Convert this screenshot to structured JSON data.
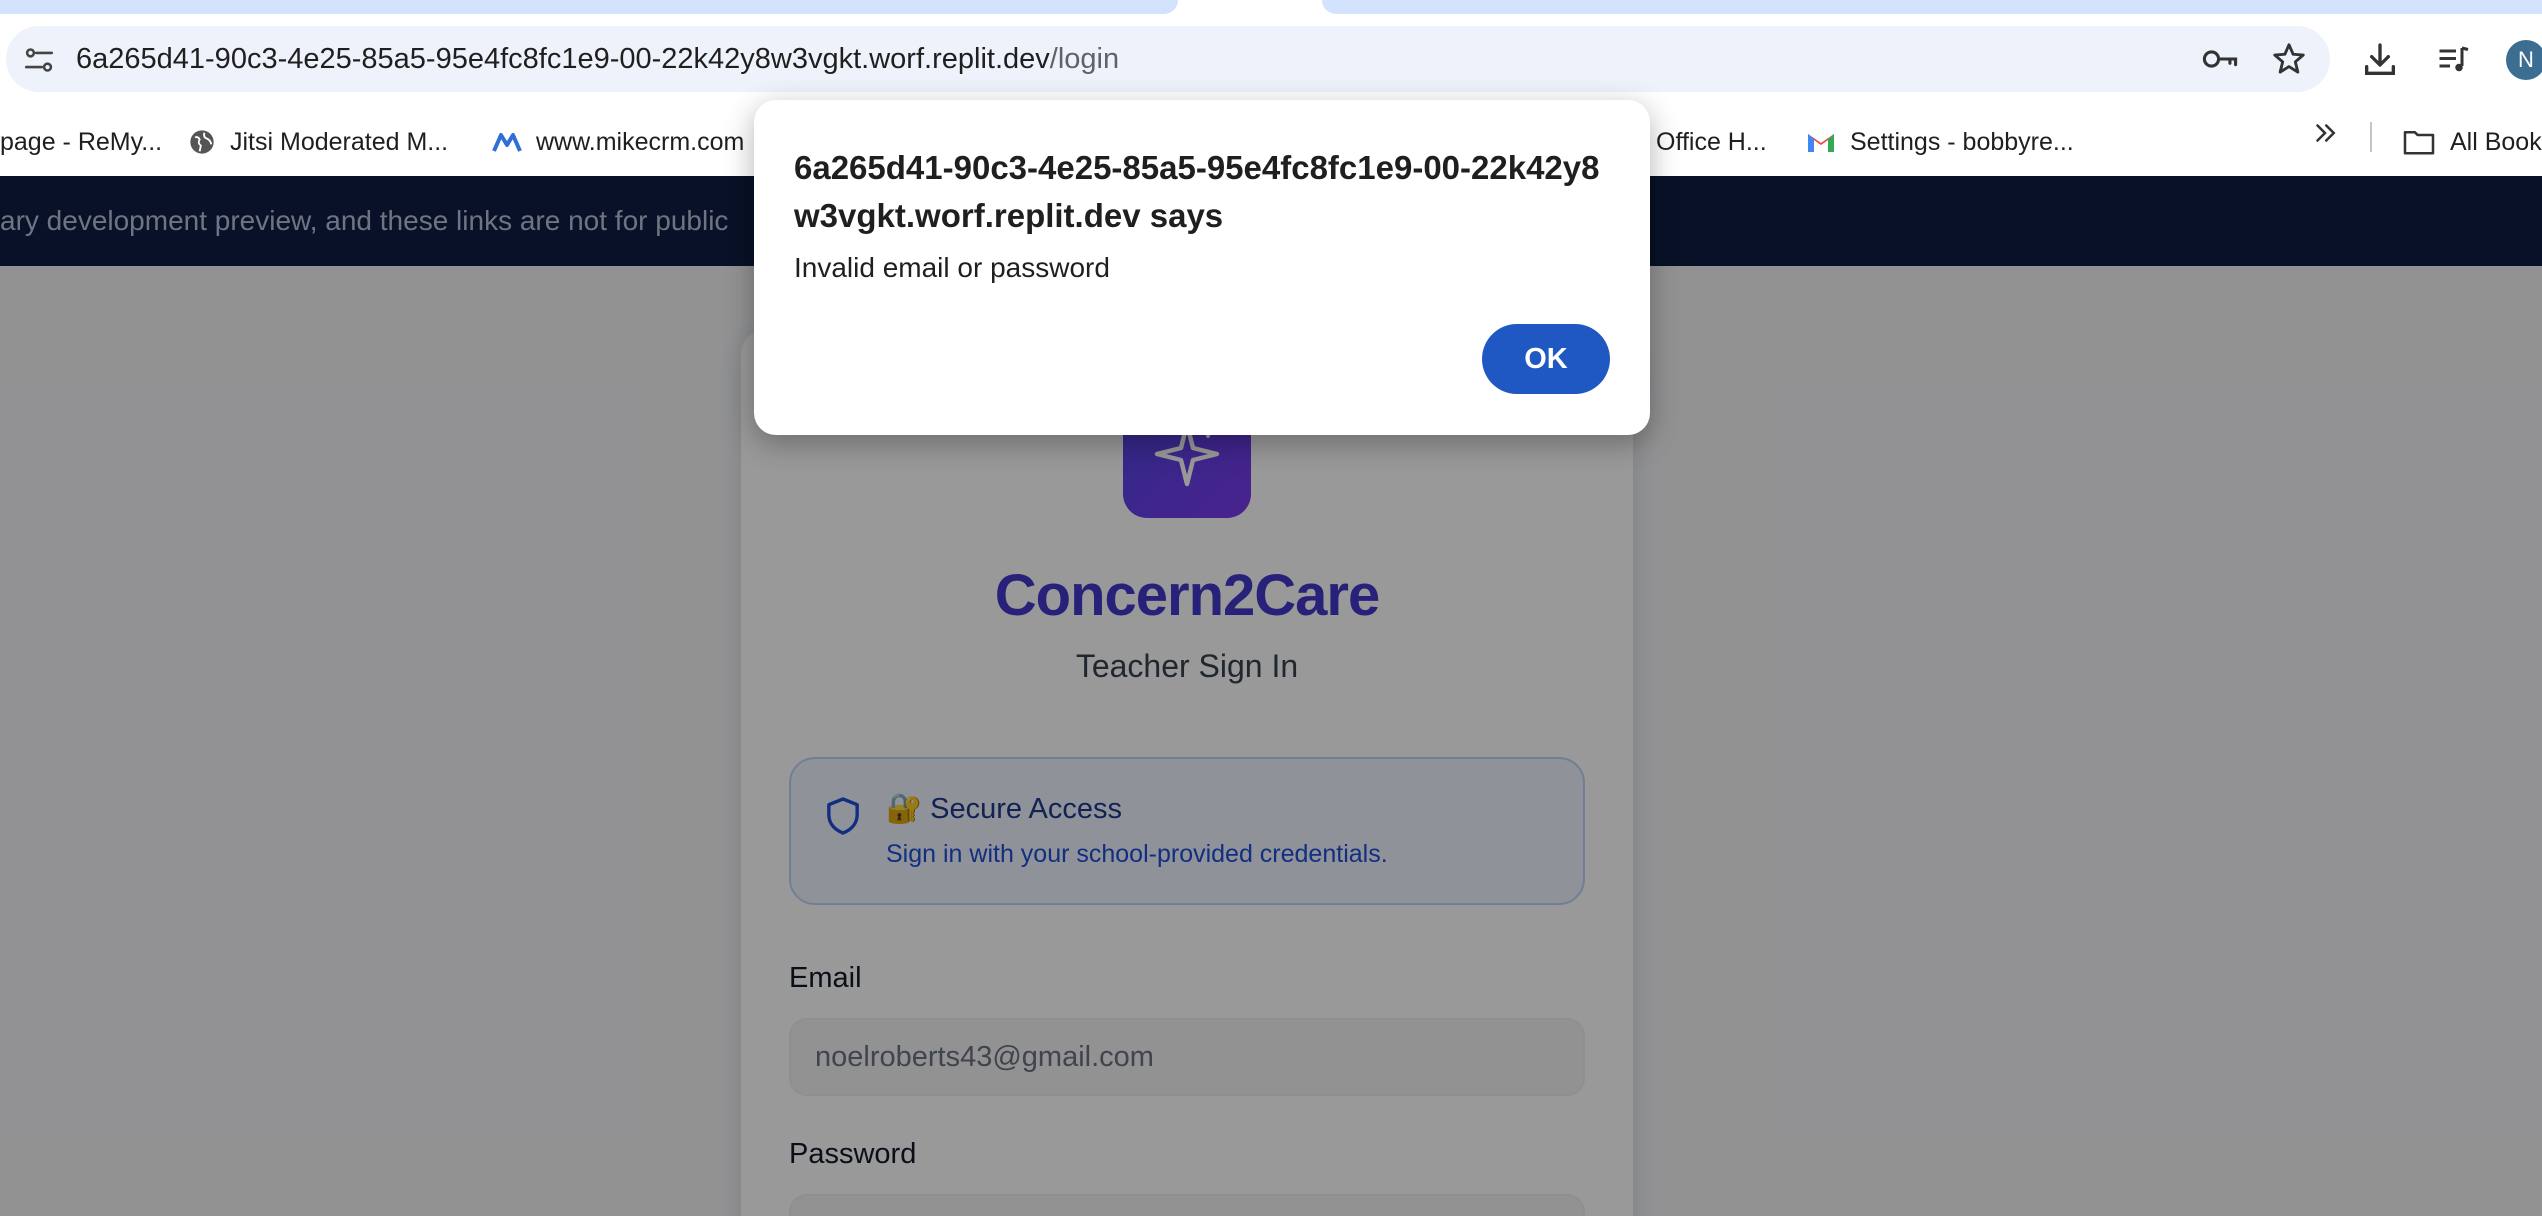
{
  "browser": {
    "address_bar": {
      "host": "6a265d41-90c3-4e25-85a5-95e4fc8fc1e9-00-22k42y8w3vgkt.worf.replit.dev",
      "path": "/login"
    },
    "profile_initial": "N",
    "bookmarks": [
      {
        "label": "page - ReMy...",
        "icon": "page-icon"
      },
      {
        "label": "Jitsi Moderated M...",
        "icon": "globe-icon"
      },
      {
        "label": "www.mikecrm.com",
        "icon": "mikecrm-icon"
      },
      {
        "label": "Office H...",
        "icon": "none"
      },
      {
        "label": "Settings - bobbyre...",
        "icon": "gmail-icon"
      },
      {
        "label": "All Book",
        "icon": "folder-icon"
      }
    ]
  },
  "page": {
    "banner_text": "ary development preview, and these links are not for public",
    "brand_name": "Concern2Care",
    "subtitle": "Teacher Sign In",
    "secure": {
      "title": "🔐 Secure Access",
      "description": "Sign in with your school-provided credentials."
    },
    "email_label": "Email",
    "email_value": "noelroberts43@gmail.com",
    "password_label": "Password"
  },
  "dialog": {
    "title": "6a265d41-90c3-4e25-85a5-95e4fc8fc1e9-00-22k42y8w3vgkt.worf.replit.dev says",
    "message": "Invalid email or password",
    "ok_label": "OK"
  }
}
